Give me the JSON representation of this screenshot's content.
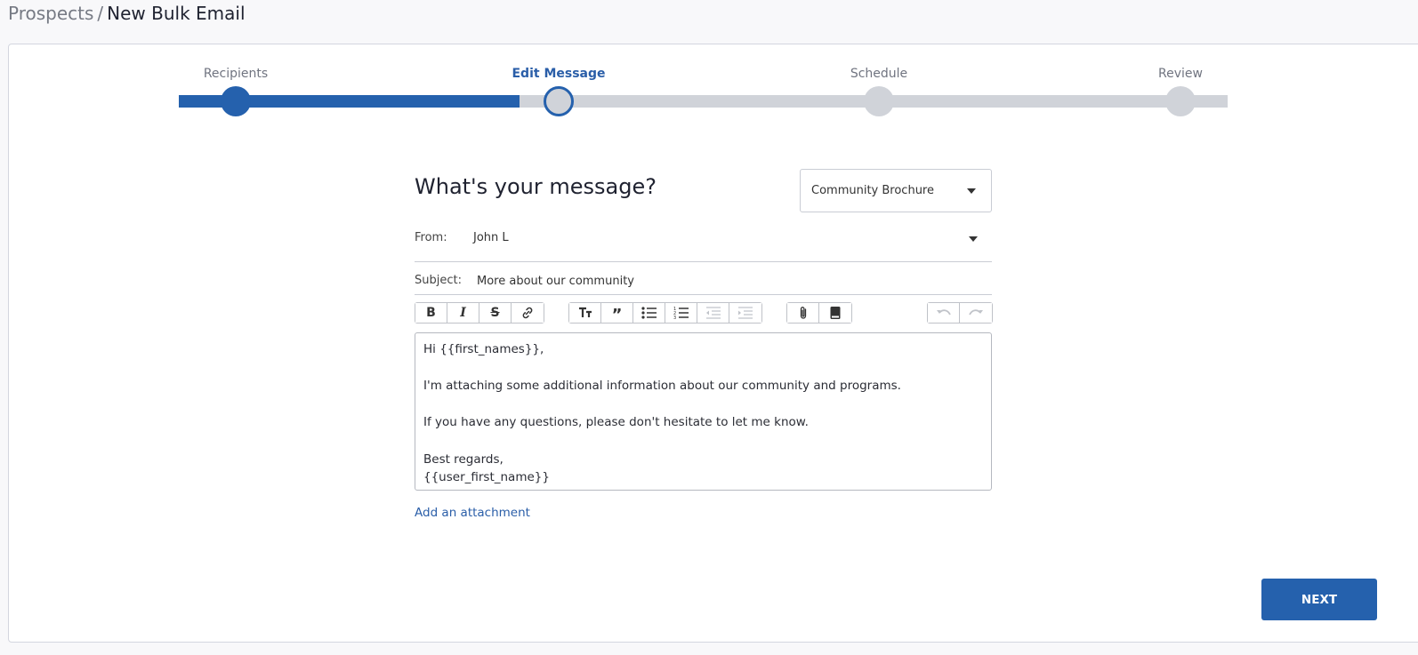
{
  "breadcrumb": {
    "root": "Prospects",
    "separator": "/",
    "current": "New Bulk Email"
  },
  "stepper": {
    "steps": [
      {
        "label": "Recipients",
        "state": "done"
      },
      {
        "label": "Edit Message",
        "state": "current"
      },
      {
        "label": "Schedule",
        "state": "todo"
      },
      {
        "label": "Review",
        "state": "todo"
      }
    ]
  },
  "form": {
    "heading": "What's your message?",
    "template_select": {
      "value": "Community Brochure"
    },
    "from": {
      "label": "From:",
      "value": "John L"
    },
    "subject": {
      "label": "Subject:",
      "value": "More about our community"
    }
  },
  "toolbar": {
    "groups": [
      [
        "bold-icon",
        "italic-icon",
        "strikethrough-icon",
        "link-icon"
      ],
      [
        "heading-icon",
        "quote-icon",
        "bullet-list-icon",
        "numbered-list-icon",
        "outdent-icon",
        "indent-icon"
      ],
      [
        "attachment-icon",
        "book-icon"
      ],
      [
        "undo-icon",
        "redo-icon"
      ]
    ]
  },
  "editor": {
    "lines": [
      "Hi {{first_names}},",
      "",
      "I'm attaching some additional information about our community and programs.",
      "",
      "If you have any questions, please don't hesitate to let me know.",
      "",
      "Best regards,",
      "{{user_first_name}}"
    ]
  },
  "attachment_link": "Add an attachment",
  "next_button": "NEXT",
  "colors": {
    "primary": "#2561ad",
    "track_inactive": "#d0d3d9",
    "link": "#2a5ea8"
  }
}
